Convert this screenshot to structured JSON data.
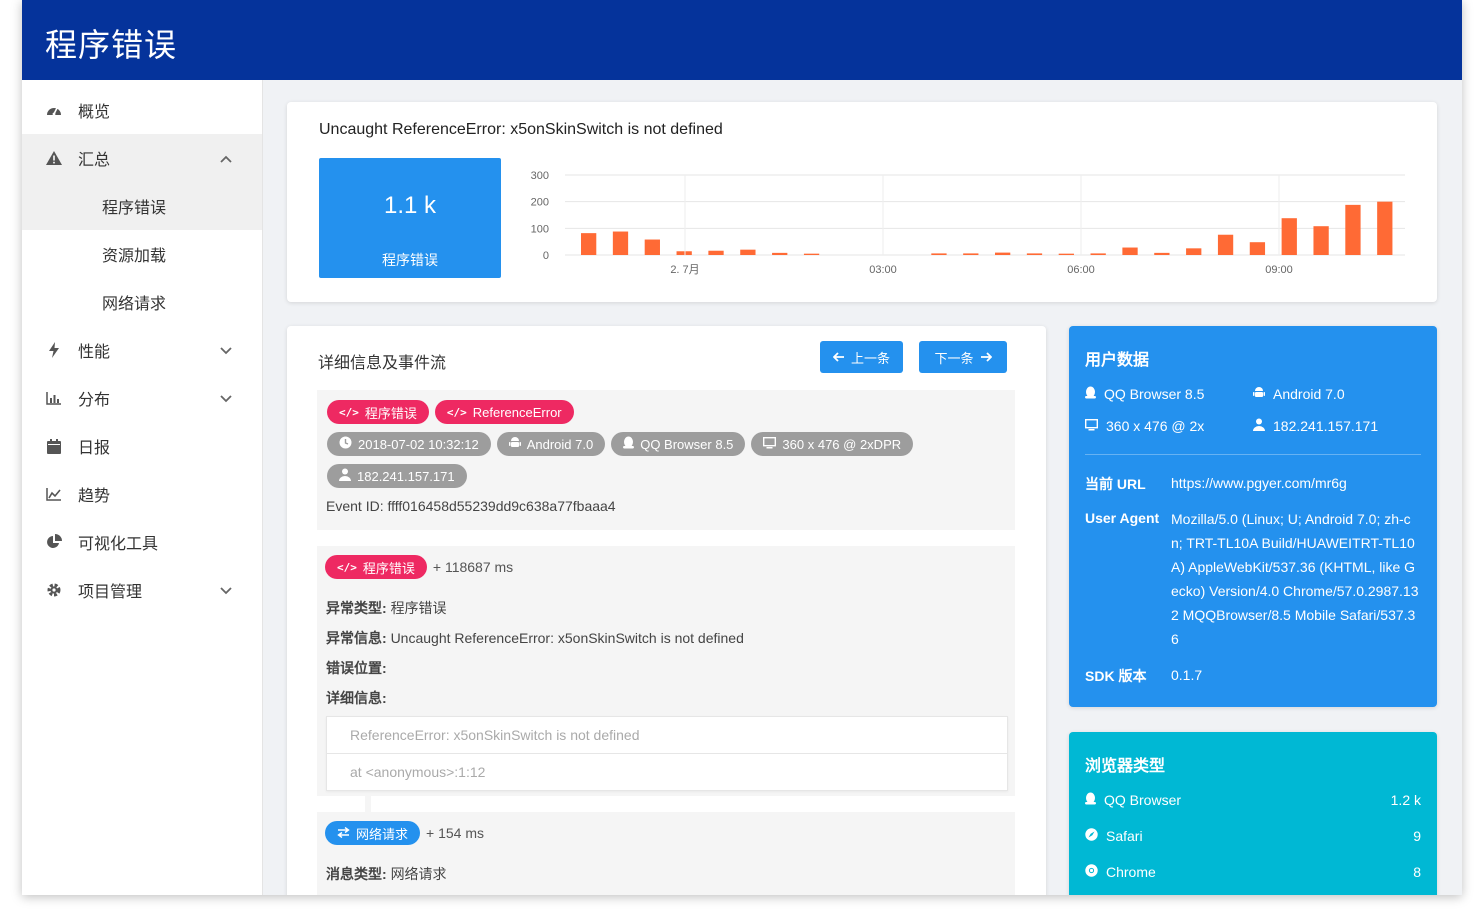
{
  "header": {
    "title": "程序错误"
  },
  "sidebar": {
    "items": [
      {
        "label": "概览",
        "icon": "dashboard-icon",
        "type": "item"
      },
      {
        "label": "汇总",
        "icon": "warning-icon",
        "type": "group-open"
      },
      {
        "label": "程序错误",
        "type": "sub-active"
      },
      {
        "label": "资源加载",
        "type": "sub"
      },
      {
        "label": "网络请求",
        "type": "sub"
      },
      {
        "label": "性能",
        "icon": "bolt-icon",
        "type": "group"
      },
      {
        "label": "分布",
        "icon": "bar-chart-icon",
        "type": "group"
      },
      {
        "label": "日报",
        "icon": "calendar-icon",
        "type": "item"
      },
      {
        "label": "趋势",
        "icon": "area-chart-icon",
        "type": "item"
      },
      {
        "label": "可视化工具",
        "icon": "pie-chart-icon",
        "type": "item"
      },
      {
        "label": "项目管理",
        "icon": "gear-icon",
        "type": "group"
      }
    ]
  },
  "summary": {
    "error_title": "Uncaught ReferenceError: x5onSkinSwitch is not defined",
    "count_value": "1.1 k",
    "count_label": "程序错误"
  },
  "chart_data": {
    "type": "bar",
    "y_ticks": [
      "300",
      "200",
      "100",
      "0"
    ],
    "ylim": [
      0,
      300
    ],
    "x_tick_labels": [
      {
        "label": "2. 7月",
        "at_hour": 0
      },
      {
        "label": "03:00",
        "at_hour": 3
      },
      {
        "label": "06:00",
        "at_hour": 6
      },
      {
        "label": "09:00",
        "at_hour": 9
      }
    ],
    "series": [
      {
        "color": "#ff6a35",
        "values": [
          82,
          88,
          58,
          14,
          16,
          20,
          8,
          5,
          0,
          0,
          0,
          6,
          6,
          9,
          6,
          5,
          6,
          28,
          8,
          25,
          76,
          48,
          138,
          108,
          188,
          200
        ]
      }
    ],
    "grid": true
  },
  "detail": {
    "title": "详细信息及事件流",
    "prev_label": "上一条",
    "next_label": "下一条",
    "tags": [
      "程序错误",
      "ReferenceError"
    ],
    "meta": {
      "time": "2018-07-02 10:32:12",
      "os": "Android 7.0",
      "browser": "QQ Browser 8.5",
      "screen": "360 x 476 @ 2xDPR",
      "ip": "182.241.157.171"
    },
    "event_id": "Event ID: ffff016458d55239dd9c638a77fbaaa4",
    "event1": {
      "tag": "程序错误",
      "offset": "+ 118687 ms",
      "type_label": "异常类型:",
      "type_value": "程序错误",
      "msg_label": "异常信息:",
      "msg_value": "Uncaught ReferenceError: x5onSkinSwitch is not defined",
      "pos_label": "错误位置:",
      "detail_label": "详细信息:",
      "stack": [
        "ReferenceError: x5onSkinSwitch is not defined",
        "at <anonymous>:1:12"
      ]
    },
    "event2": {
      "tag": "网络请求",
      "offset": "+ 154 ms",
      "type_label": "消息类型:",
      "type_value": "网络请求"
    }
  },
  "user": {
    "title": "用户数据",
    "browser": "QQ Browser 8.5",
    "os": "Android 7.0",
    "screen": "360 x 476 @ 2x",
    "ip": "182.241.157.171",
    "url_label": "当前 URL",
    "url": "https://www.pgyer.com/mr6g",
    "ua_label": "User Agent",
    "ua": "Mozilla/5.0 (Linux; U; Android 7.0; zh-cn; TRT-TL10A Build/HUAWEITRT-TL10A) AppleWebKit/537.36 (KHTML, like Gecko) Version/4.0 Chrome/57.0.2987.132 MQQBrowser/8.5 Mobile Safari/537.36",
    "sdk_label": "SDK 版本",
    "sdk": "0.1.7"
  },
  "browsers": {
    "title": "浏览器类型",
    "items": [
      {
        "name": "QQ Browser",
        "count": "1.2 k",
        "icon": "qq-icon"
      },
      {
        "name": "Safari",
        "count": "9",
        "icon": "compass-icon"
      },
      {
        "name": "Chrome",
        "count": "8",
        "icon": "chrome-icon"
      }
    ]
  },
  "colors": {
    "header": "#05339b",
    "accent": "#2491ee",
    "error_tag": "#ee2962",
    "bar": "#ff6a35",
    "browser_card": "#00b8d4"
  }
}
